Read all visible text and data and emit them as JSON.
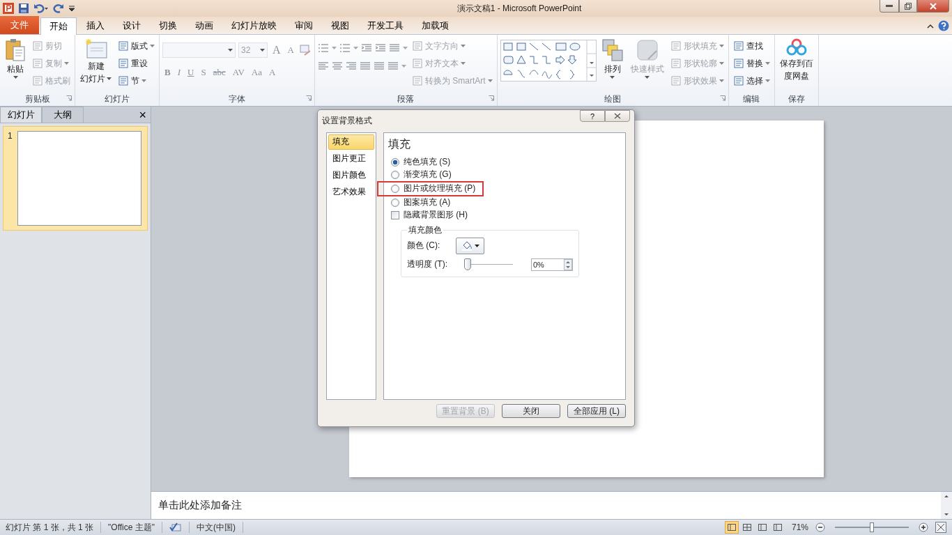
{
  "title_bar": {
    "title": "演示文稿1  -  Microsoft PowerPoint"
  },
  "ribbon_tabs": [
    {
      "label": "文件",
      "kind": "file",
      "selected": false
    },
    {
      "label": "开始",
      "kind": "tab",
      "selected": true
    },
    {
      "label": "插入",
      "kind": "tab",
      "selected": false
    },
    {
      "label": "设计",
      "kind": "tab",
      "selected": false
    },
    {
      "label": "切换",
      "kind": "tab",
      "selected": false
    },
    {
      "label": "动画",
      "kind": "tab",
      "selected": false
    },
    {
      "label": "幻灯片放映",
      "kind": "tab",
      "selected": false
    },
    {
      "label": "审阅",
      "kind": "tab",
      "selected": false
    },
    {
      "label": "视图",
      "kind": "tab",
      "selected": false
    },
    {
      "label": "开发工具",
      "kind": "tab",
      "selected": false
    },
    {
      "label": "加载项",
      "kind": "tab",
      "selected": false
    }
  ],
  "ribbon_groups": [
    {
      "label": "剪贴板",
      "launcher": true,
      "blocks": [
        {
          "kind": "large",
          "lines": [
            "粘贴"
          ],
          "dropdown": true,
          "disabled": false
        },
        {
          "kind": "stack",
          "items": [
            {
              "label": "剪切",
              "dropdown": false,
              "disabled": true
            },
            {
              "label": "复制",
              "dropdown": true,
              "disabled": true
            },
            {
              "label": "格式刷",
              "dropdown": false,
              "disabled": true
            }
          ]
        }
      ]
    },
    {
      "label": "幻灯片",
      "launcher": false,
      "blocks": [
        {
          "kind": "large",
          "lines": [
            "新建",
            "幻灯片"
          ],
          "dropdown": true,
          "disabled": false
        },
        {
          "kind": "stack",
          "items": [
            {
              "label": "版式",
              "dropdown": true,
              "disabled": false
            },
            {
              "label": "重设",
              "dropdown": false,
              "disabled": false
            },
            {
              "label": "节",
              "dropdown": true,
              "disabled": false
            }
          ]
        }
      ]
    },
    {
      "label": "字体",
      "launcher": true,
      "blocks": [
        {
          "kind": "font",
          "size": "32",
          "grow": [
            "A",
            "A"
          ],
          "formats": [
            "B",
            "I",
            "U",
            "S",
            "abc",
            "AV",
            "Aa",
            "A"
          ]
        }
      ]
    },
    {
      "label": "段落",
      "launcher": true,
      "blocks": [
        {
          "kind": "paragraph"
        },
        {
          "kind": "stack",
          "items": [
            {
              "label": "文字方向",
              "dropdown": true,
              "disabled": true
            },
            {
              "label": "对齐文本",
              "dropdown": true,
              "disabled": true
            },
            {
              "label": "转换为 SmartArt",
              "dropdown": true,
              "disabled": true
            }
          ]
        }
      ]
    },
    {
      "label": "绘图",
      "launcher": true,
      "blocks": [
        {
          "kind": "shapes"
        },
        {
          "kind": "large",
          "lines": [
            "排列"
          ],
          "dropdown": true,
          "disabled": false
        },
        {
          "kind": "large",
          "lines": [
            "快速样式"
          ],
          "dropdown": true,
          "disabled": true
        },
        {
          "kind": "stack",
          "items": [
            {
              "label": "形状填充",
              "dropdown": true,
              "disabled": true
            },
            {
              "label": "形状轮廓",
              "dropdown": true,
              "disabled": true
            },
            {
              "label": "形状效果",
              "dropdown": true,
              "disabled": true
            }
          ]
        }
      ]
    },
    {
      "label": "编辑",
      "launcher": false,
      "blocks": [
        {
          "kind": "stack",
          "items": [
            {
              "label": "查找",
              "dropdown": false,
              "disabled": false
            },
            {
              "label": "替换",
              "dropdown": true,
              "disabled": false
            },
            {
              "label": "选择",
              "dropdown": true,
              "disabled": false
            }
          ]
        }
      ]
    },
    {
      "label": "保存",
      "launcher": false,
      "blocks": [
        {
          "kind": "large",
          "lines": [
            "保存到百",
            "度网盘"
          ],
          "dropdown": false,
          "disabled": false
        }
      ]
    }
  ],
  "slide_panel": {
    "tabs": [
      {
        "label": "幻灯片",
        "selected": true
      },
      {
        "label": "大纲",
        "selected": false
      }
    ],
    "close": "×",
    "thumbnails": [
      {
        "number": "1",
        "selected": true
      }
    ]
  },
  "dialog": {
    "title": "设置背景格式",
    "help": "?",
    "nav": [
      {
        "label": "填充",
        "selected": true
      },
      {
        "label": "图片更正",
        "selected": false
      },
      {
        "label": "图片颜色",
        "selected": false
      },
      {
        "label": "艺术效果",
        "selected": false
      }
    ],
    "heading": "填充",
    "options": [
      {
        "kind": "radio",
        "label": "纯色填充 (S)",
        "checked": true,
        "highlighted": false
      },
      {
        "kind": "radio",
        "label": "渐变填充 (G)",
        "checked": false,
        "highlighted": false
      },
      {
        "kind": "radio",
        "label": "图片或纹理填充 (P)",
        "checked": false,
        "highlighted": true
      },
      {
        "kind": "radio",
        "label": "图案填充 (A)",
        "checked": false,
        "highlighted": false
      },
      {
        "kind": "checkbox",
        "label": "隐藏背景图形 (H)",
        "checked": false,
        "highlighted": false
      }
    ],
    "fill_color": {
      "legend": "填充颜色",
      "color_label": "颜色 (C):",
      "transparency_label": "透明度 (T):",
      "transparency": {
        "level": 0
      },
      "transparency_value": "0%"
    },
    "buttons": [
      {
        "label": "重置背景 (B)",
        "disabled": true
      },
      {
        "label": "关闭",
        "disabled": false
      },
      {
        "label": "全部应用 (L)",
        "disabled": false
      }
    ]
  },
  "notes": {
    "placeholder": "单击此处添加备注"
  },
  "status_bar": {
    "slide_info": "幻灯片 第 1 张，共 1 张",
    "theme": "\"Office 主题\"",
    "language": "中文(中国)",
    "views": [
      {
        "selected": true
      },
      {
        "selected": false
      },
      {
        "selected": false
      },
      {
        "selected": false
      }
    ],
    "zoom_text": "71%",
    "zoom": {
      "level": 0.5
    }
  }
}
